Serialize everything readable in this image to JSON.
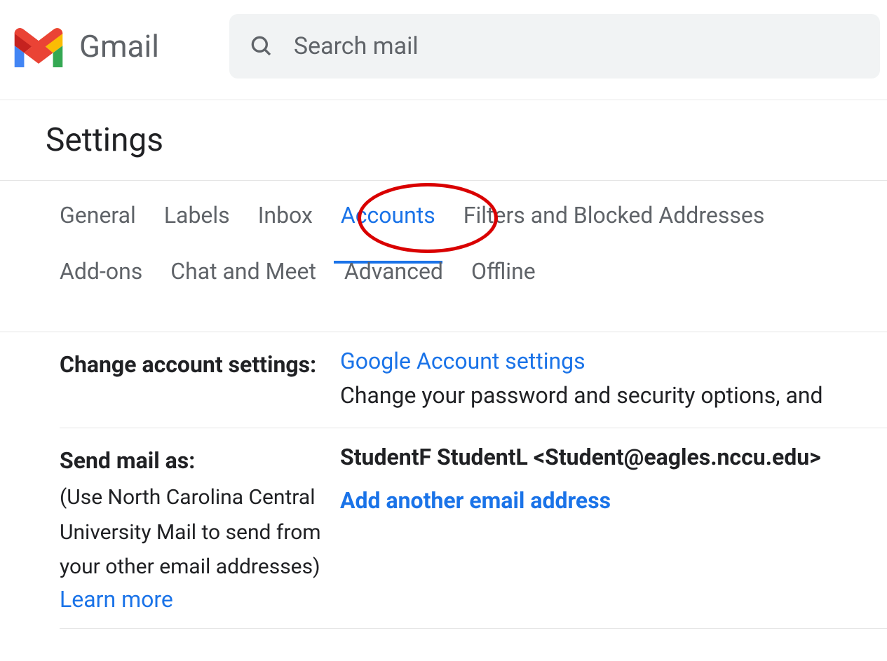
{
  "header": {
    "app_name": "Gmail",
    "search_placeholder": "Search mail"
  },
  "page_title": "Settings",
  "tabs": {
    "row1": [
      {
        "id": "general",
        "label": "General",
        "active": false
      },
      {
        "id": "labels",
        "label": "Labels",
        "active": false
      },
      {
        "id": "inbox",
        "label": "Inbox",
        "active": false
      },
      {
        "id": "accounts",
        "label": "Accounts",
        "active": true
      },
      {
        "id": "filters",
        "label": "Filters and Blocked Addresses",
        "active": false
      }
    ],
    "row2": [
      {
        "id": "addons",
        "label": "Add-ons",
        "active": false
      },
      {
        "id": "chat",
        "label": "Chat and Meet",
        "active": false
      },
      {
        "id": "advanced",
        "label": "Advanced",
        "active": false
      },
      {
        "id": "offline",
        "label": "Offline",
        "active": false
      }
    ]
  },
  "sections": {
    "change_account": {
      "label": "Change account settings:",
      "link": "Google Account settings",
      "description": "Change your password and security options, and"
    },
    "send_mail_as": {
      "label": "Send mail as:",
      "sublabel": "(Use North Carolina Central University Mail to send from your other email addresses)",
      "learn_more": "Learn more",
      "identity": "StudentF StudentL <Student@eagles.nccu.edu>",
      "add_link": "Add another email address"
    }
  }
}
